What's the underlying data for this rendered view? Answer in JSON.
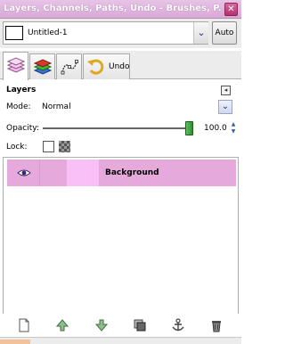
{
  "window": {
    "title": "Layers, Channels, Paths, Undo - Brushes, P...",
    "close_glyph": "✕"
  },
  "image_selector": {
    "name": "Untitled-1",
    "dropdown_glyph": "⌄",
    "auto_label": "Auto"
  },
  "tabs": [
    {
      "icon": "layers-tab-icon",
      "label": ""
    },
    {
      "icon": "channels-tab-icon",
      "label": ""
    },
    {
      "icon": "paths-tab-icon",
      "label": ""
    },
    {
      "icon": "undo-tab-icon",
      "label": "Undo"
    }
  ],
  "layers_panel": {
    "title": "Layers",
    "menu_glyph": "◂",
    "mode_label": "Mode:",
    "mode_value": "Normal",
    "opacity_label": "Opacity:",
    "opacity_value": "100.0",
    "opacity_fraction": 1.0,
    "lock_label": "Lock:",
    "layers": [
      {
        "name": "Background",
        "visible": true,
        "thumbnail_color": "#f8c0f6",
        "row_color": "#e5a9dc"
      }
    ]
  },
  "bottom_buttons": [
    {
      "icon": "new-layer-icon"
    },
    {
      "icon": "raise-layer-icon"
    },
    {
      "icon": "lower-layer-icon"
    },
    {
      "icon": "duplicate-layer-icon"
    },
    {
      "icon": "anchor-layer-icon"
    },
    {
      "icon": "delete-layer-icon"
    }
  ]
}
